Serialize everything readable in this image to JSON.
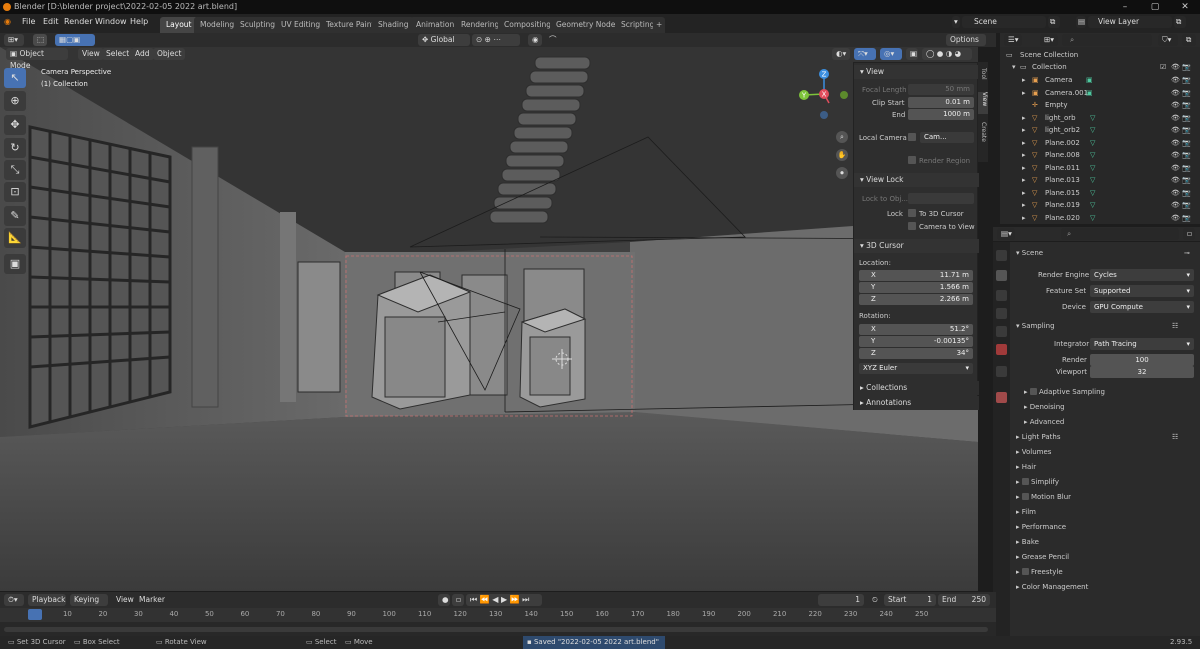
{
  "titlebar": {
    "title": "Blender [D:\\blender project\\2022-02-05 2022 art.blend]"
  },
  "menu": {
    "items": [
      "File",
      "Edit",
      "Render",
      "Window",
      "Help"
    ]
  },
  "workspaces": [
    "Layout",
    "Modeling",
    "Sculpting",
    "UV Editing",
    "Texture Paint",
    "Shading",
    "Animation",
    "Rendering",
    "Compositing",
    "Geometry Nodes",
    "Scripting",
    "+"
  ],
  "active_workspace": "Layout",
  "scene": {
    "label": "Scene",
    "view_layer": "View Layer"
  },
  "viewport_header": {
    "mode": "Object Mode",
    "menus": [
      "View",
      "Select",
      "Add",
      "Object"
    ],
    "transform": "Global",
    "options": "Options"
  },
  "viewport": {
    "overlay_line1": "Camera Perspective",
    "overlay_line2": "(1) Collection"
  },
  "npanel": {
    "tabs": [
      "Tool",
      "View",
      "Create"
    ],
    "view_header": "View",
    "focal_length_label": "Focal Length",
    "focal_length": "50 mm",
    "clip_start_label": "Clip Start",
    "clip_start": "0.01 m",
    "end_label": "End",
    "end": "1000 m",
    "local_camera_label": "Local Camera",
    "local_camera_value": "Cam...",
    "render_region": "Render Region",
    "view_lock_header": "View Lock",
    "lock_to_obj": "Lock to Obj...",
    "lock_label": "Lock",
    "to_3d_cursor": "To 3D Cursor",
    "camera_to_view": "Camera to View",
    "cursor_header": "3D Cursor",
    "location_label": "Location:",
    "loc_x": "11.71 m",
    "loc_y": "1.566 m",
    "loc_z": "2.266 m",
    "rotation_label": "Rotation:",
    "rot_x": "51.2°",
    "rot_y": "-0.00135°",
    "rot_z": "34°",
    "rotation_mode": "XYZ Euler",
    "collections": "Collections",
    "annotations": "Annotations",
    "axis_x": "X",
    "axis_y": "Y",
    "axis_z": "Z"
  },
  "outliner": {
    "root": "Scene Collection",
    "collection": "Collection",
    "items": [
      "Camera",
      "Camera.001",
      "Empty",
      "light_orb",
      "light_orb2",
      "Plane.002",
      "Plane.008",
      "Plane.011",
      "Plane.013",
      "Plane.015",
      "Plane.019",
      "Plane.020"
    ]
  },
  "properties": {
    "scene": "Scene",
    "render_engine_label": "Render Engine",
    "render_engine": "Cycles",
    "feature_set_label": "Feature Set",
    "feature_set": "Supported",
    "device_label": "Device",
    "device": "GPU Compute",
    "sampling": "Sampling",
    "integrator_label": "Integrator",
    "integrator": "Path Tracing",
    "render_label": "Render",
    "render_samples": "100",
    "viewport_label": "Viewport",
    "viewport_samples": "32",
    "adaptive_sampling": "Adaptive Sampling",
    "denoising": "Denoising",
    "advanced": "Advanced",
    "panels": [
      "Light Paths",
      "Volumes",
      "Hair",
      "Simplify",
      "Motion Blur",
      "Film",
      "Performance",
      "Bake",
      "Grease Pencil",
      "Freestyle",
      "Color Management"
    ]
  },
  "timeline": {
    "menus": [
      "Playback",
      "Keying",
      "View",
      "Marker"
    ],
    "current_frame": "1",
    "start_label": "Start",
    "start": "1",
    "end_label": "End",
    "end": "250",
    "ticks": [
      "1",
      "10",
      "20",
      "30",
      "40",
      "50",
      "60",
      "70",
      "80",
      "90",
      "100",
      "110",
      "120",
      "130",
      "140",
      "150",
      "160",
      "170",
      "180",
      "190",
      "200",
      "210",
      "220",
      "230",
      "240",
      "250"
    ]
  },
  "statusbar": {
    "set_cursor": "Set 3D Cursor",
    "box_select": "Box Select",
    "rotate_view": "Rotate View",
    "select": "Select",
    "move": "Move",
    "message": "Saved \"2022-02-05 2022 art.blend\"",
    "version": "2.93.5"
  },
  "colors": {
    "accent": "#4772b3",
    "orange": "#e87d0d",
    "x_axis": "#e04d5c",
    "y_axis": "#7ec33a",
    "z_axis": "#3b8fe0"
  }
}
